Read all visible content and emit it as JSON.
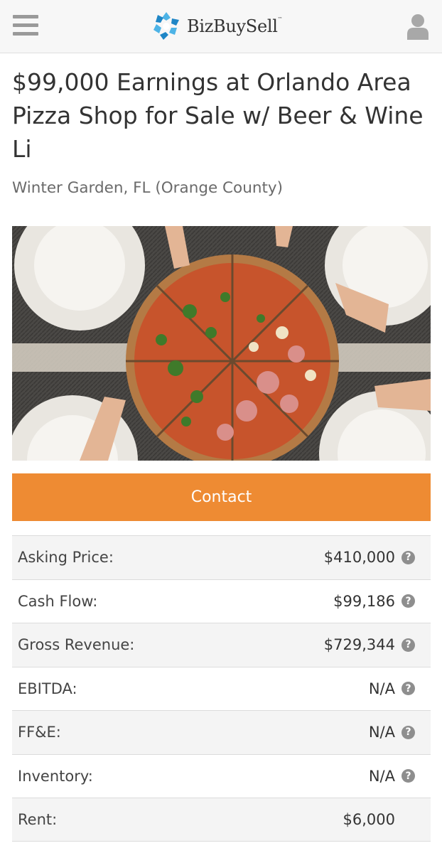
{
  "header": {
    "brand": "BizBuySell",
    "trademark": "™",
    "menu_icon": "hamburger-icon",
    "user_icon": "user-icon",
    "brand_color": "#1f86c6"
  },
  "listing": {
    "title": "$99,000 Earnings at Orlando Area Pizza Shop for Sale w/ Beer & Wine Li",
    "location": "Winter Garden, FL (Orange County)",
    "image_icon": "pizza-photo"
  },
  "contact": {
    "label": "Contact",
    "color": "#ee8b33"
  },
  "financials": [
    {
      "label": "Asking Price:",
      "value": "$410,000",
      "help": "?"
    },
    {
      "label": "Cash Flow:",
      "value": "$99,186",
      "help": "?"
    },
    {
      "label": "Gross Revenue:",
      "value": "$729,344",
      "help": "?"
    },
    {
      "label": "EBITDA:",
      "value": "N/A",
      "help": "?"
    },
    {
      "label": "FF&E:",
      "value": "N/A",
      "help": "?"
    },
    {
      "label": "Inventory:",
      "value": "N/A",
      "help": "?"
    },
    {
      "label": "Rent:",
      "value": "$6,000",
      "help": ""
    }
  ]
}
